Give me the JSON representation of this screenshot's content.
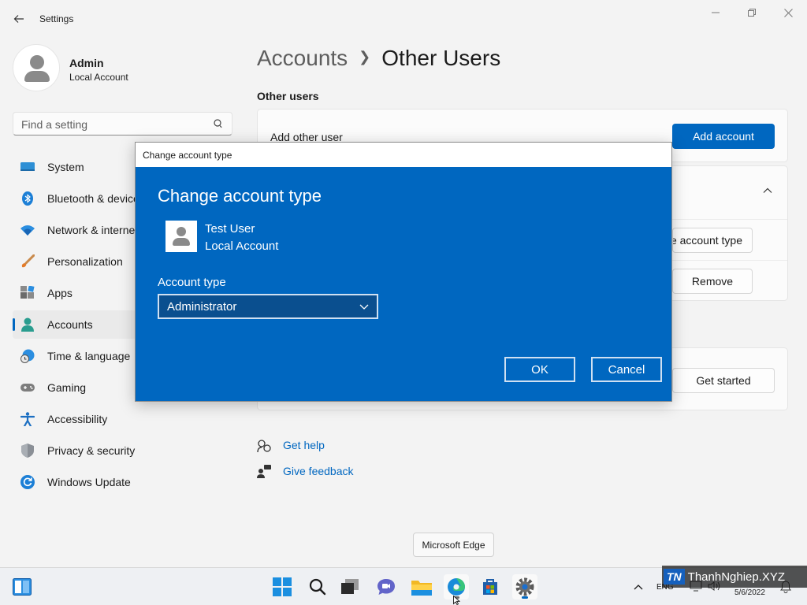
{
  "window": {
    "title": "Settings",
    "controls": [
      "minimize",
      "maximize",
      "close"
    ]
  },
  "profile": {
    "name": "Admin",
    "account_type": "Local Account"
  },
  "search": {
    "placeholder": "Find a setting"
  },
  "nav": {
    "items": [
      {
        "label": "System",
        "icon": "monitor-icon"
      },
      {
        "label": "Bluetooth & devices",
        "icon": "bluetooth-icon"
      },
      {
        "label": "Network & internet",
        "icon": "wifi-icon"
      },
      {
        "label": "Personalization",
        "icon": "brush-icon"
      },
      {
        "label": "Apps",
        "icon": "apps-icon"
      },
      {
        "label": "Accounts",
        "icon": "person-icon",
        "selected": true
      },
      {
        "label": "Time & language",
        "icon": "globe-clock-icon"
      },
      {
        "label": "Gaming",
        "icon": "gamepad-icon"
      },
      {
        "label": "Accessibility",
        "icon": "accessibility-icon"
      },
      {
        "label": "Privacy & security",
        "icon": "shield-icon"
      },
      {
        "label": "Windows Update",
        "icon": "update-icon"
      }
    ]
  },
  "main": {
    "breadcrumb_parent": "Accounts",
    "breadcrumb_current": "Other Users",
    "section_title": "Other users",
    "add_other_user_label": "Add other user",
    "add_account_button": "Add account",
    "change_account_type_button": "e account type",
    "remove_button": "Remove",
    "get_started_button": "Get started",
    "help_links": [
      "Get help",
      "Give feedback"
    ]
  },
  "dialog": {
    "window_title": "Change account type",
    "heading": "Change account type",
    "user_name": "Test User",
    "user_account": "Local Account",
    "field_label": "Account type",
    "selected_value": "Administrator",
    "ok_button": "OK",
    "cancel_button": "Cancel"
  },
  "tooltip": {
    "text": "Microsoft Edge"
  },
  "taskbar": {
    "apps": [
      "start-icon",
      "search-icon",
      "task-view-icon",
      "chat-icon",
      "file-explorer-icon",
      "edge-icon",
      "store-icon",
      "settings-icon"
    ],
    "language": "ENG",
    "date": "5/6/2022"
  },
  "watermark": {
    "badge": "TN",
    "text": "ThanhNghiep.XYZ"
  },
  "colors": {
    "accent": "#0067c0",
    "background": "#f3f3f3",
    "card": "#fbfbfb"
  }
}
